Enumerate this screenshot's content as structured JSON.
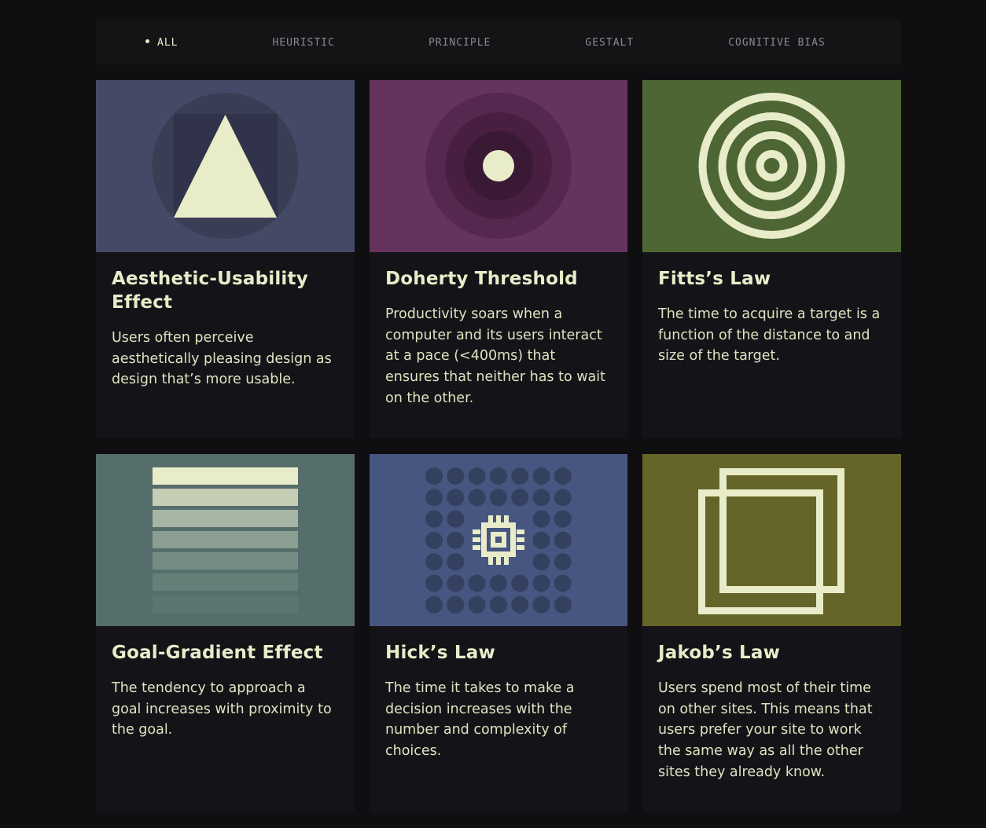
{
  "filters": [
    {
      "label": "ALL",
      "active": true
    },
    {
      "label": "HEURISTIC",
      "active": false
    },
    {
      "label": "PRINCIPLE",
      "active": false
    },
    {
      "label": "GESTALT",
      "active": false
    },
    {
      "label": "COGNITIVE BIAS",
      "active": false
    }
  ],
  "cards": [
    {
      "title": "Aesthetic-Usability Effect",
      "description": "Users often perceive aesthetically pleasing design as design that’s more usable.",
      "color": "#444a66",
      "icon": "triangle-icon"
    },
    {
      "title": "Doherty Threshold",
      "description": "Productivity soars when a computer and its users interact at a pace (<400ms) that ensures that neither has to wait on the other.",
      "color": "#66335e",
      "icon": "concentric-circles-icon"
    },
    {
      "title": "Fitts’s Law",
      "description": "The time to acquire a target is a function of the distance to and size of the target.",
      "color": "#4e6634",
      "icon": "target-icon"
    },
    {
      "title": "Goal-Gradient Effect",
      "description": "The tendency to approach a goal increases with proximity to the goal.",
      "color": "#566e6b",
      "icon": "gradient-bars-icon"
    },
    {
      "title": "Hick’s Law",
      "description": "The time it takes to make a decision increases with the number and complexity of choices.",
      "color": "#465680",
      "icon": "chip-icon"
    },
    {
      "title": "Jakob’s Law",
      "description": "Users spend most of their time on other sites. This means that users prefer your site to work the same way as all the other sites they already know.",
      "color": "#666529",
      "icon": "overlapping-squares-icon"
    }
  ],
  "colors": {
    "ink": "#e8ecc9",
    "background": "#0f0f12",
    "card": "#141418"
  }
}
